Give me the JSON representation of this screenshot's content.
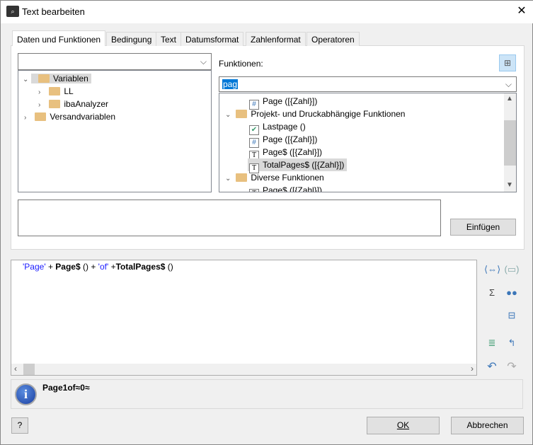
{
  "window": {
    "title": "Text bearbeiten",
    "close": "✕"
  },
  "tabs": [
    {
      "label": "Daten und Funktionen"
    },
    {
      "label": "Bedingung"
    },
    {
      "label": "Text"
    },
    {
      "label": "Datumsformat"
    },
    {
      "label": "Zahlenformat"
    },
    {
      "label": "Operatoren"
    }
  ],
  "left": {
    "combo_value": "",
    "tree": [
      {
        "label": "Variablen",
        "level": 0,
        "expanded": true,
        "selected": true
      },
      {
        "label": "LL",
        "level": 1
      },
      {
        "label": "ibaAnalyzer",
        "level": 1
      },
      {
        "label": "Versandvariablen",
        "level": 0
      }
    ]
  },
  "functions": {
    "label": "Funktionen:",
    "search_value": "pag",
    "tree": [
      {
        "label": "Page ([{Zahl}])",
        "type": "number"
      },
      {
        "label": "Projekt- und Druckabhängige Funktionen",
        "type": "folder"
      },
      {
        "label": "Lastpage ()",
        "type": "bool"
      },
      {
        "label": "Page ([{Zahl}])",
        "type": "number"
      },
      {
        "label": "Page$ ([{Zahl}])",
        "type": "text"
      },
      {
        "label": "TotalPages$ ([{Zahl}])",
        "type": "text",
        "selected": true
      },
      {
        "label": "Diverse Funktionen",
        "type": "folder"
      },
      {
        "label": "Page$ ([{Zahl}])",
        "type": "text"
      }
    ]
  },
  "insert_button": "Einfügen",
  "editor": {
    "tokens": [
      {
        "t": "'Page'",
        "k": "str"
      },
      {
        "t": " + ",
        "k": "op"
      },
      {
        "t": "Page$",
        "k": "fn"
      },
      {
        "t": " () + ",
        "k": "op"
      },
      {
        "t": "'of'",
        "k": "str"
      },
      {
        "t": " +",
        "k": "op"
      },
      {
        "t": "TotalPages$",
        "k": "fn"
      },
      {
        "t": " ()",
        "k": "op"
      }
    ]
  },
  "result": {
    "text": "Page1of≈0≈"
  },
  "buttons": {
    "ok": "OK",
    "cancel": "Abbrechen",
    "help": "?"
  },
  "colors": {
    "string": "#1a1aff",
    "selection": "#0078d7"
  }
}
